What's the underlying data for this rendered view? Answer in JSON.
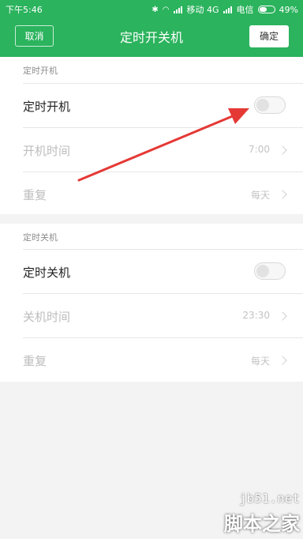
{
  "status_bar": {
    "time": "下午5:46",
    "carrier1": "移动 4G",
    "carrier2": "电信",
    "battery": "49%"
  },
  "nav": {
    "cancel_label": "取消",
    "title": "定时开关机",
    "confirm_label": "确定"
  },
  "power_on": {
    "section_label": "定时开机",
    "toggle_label": "定时开机",
    "toggle_on": false,
    "time_label": "开机时间",
    "time_value": "7:00",
    "repeat_label": "重复",
    "repeat_value": "每天"
  },
  "power_off": {
    "section_label": "定时关机",
    "toggle_label": "定时关机",
    "toggle_on": false,
    "time_label": "关机时间",
    "time_value": "23:30",
    "repeat_label": "重复",
    "repeat_value": "每天"
  },
  "watermark": {
    "url": "jb51.net",
    "name": "脚本之家"
  },
  "colors": {
    "accent": "#2bb35d",
    "annotation_arrow": "#e53935"
  }
}
